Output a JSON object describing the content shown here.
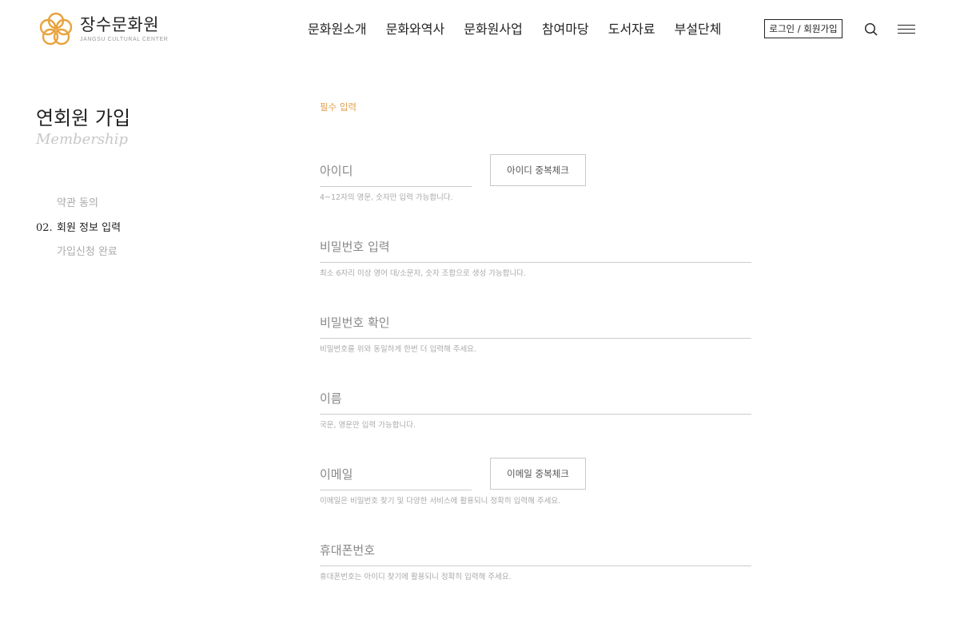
{
  "header": {
    "logo": {
      "name_ko": "장수문화원",
      "name_en": "JANGSU CULTURAL CENTER"
    },
    "nav": [
      "문화원소개",
      "문화와역사",
      "문화원사업",
      "참여마당",
      "도서자료",
      "부설단체"
    ],
    "login_label": "로그인 / 회원가입",
    "accent": "#E8A33D"
  },
  "sidebar": {
    "title": "연회원 가입",
    "subtitle": "Membership",
    "steps": [
      {
        "num": "",
        "label": "약관 동의"
      },
      {
        "num": "02.",
        "label": "회원 정보 입력"
      },
      {
        "num": "",
        "label": "가입신청 완료"
      }
    ]
  },
  "form": {
    "required_label": "필수 입력",
    "id": {
      "placeholder": "아이디",
      "value": "",
      "hint": "4~12자의 영문, 숫자만 입력 가능합니다.",
      "button": "아이디 중복체크"
    },
    "password": {
      "placeholder": "비밀번호 입력",
      "value": "",
      "hint": "최소 6자리 이상 영어 대/소문자, 숫자 조합으로 생성 가능합니다."
    },
    "password_confirm": {
      "placeholder": "비밀번호 확인",
      "value": "",
      "hint": "비밀번호를 위와 동일하게 한번 더 입력해 주세요."
    },
    "name": {
      "placeholder": "이름",
      "value": "",
      "hint": "국문, 영문만 입력 가능합니다."
    },
    "email": {
      "placeholder": "이메일",
      "value": "",
      "hint": "이메일은 비밀번호 찾기 및 다양한 서비스에 활용되니 정확히 입력해 주세요.",
      "button": "이메일 중복체크"
    },
    "phone": {
      "placeholder": "휴대폰번호",
      "value": "",
      "hint": "휴대폰번호는 아이디 찾기에 활용되니 정확히 입력해 주세요."
    }
  }
}
